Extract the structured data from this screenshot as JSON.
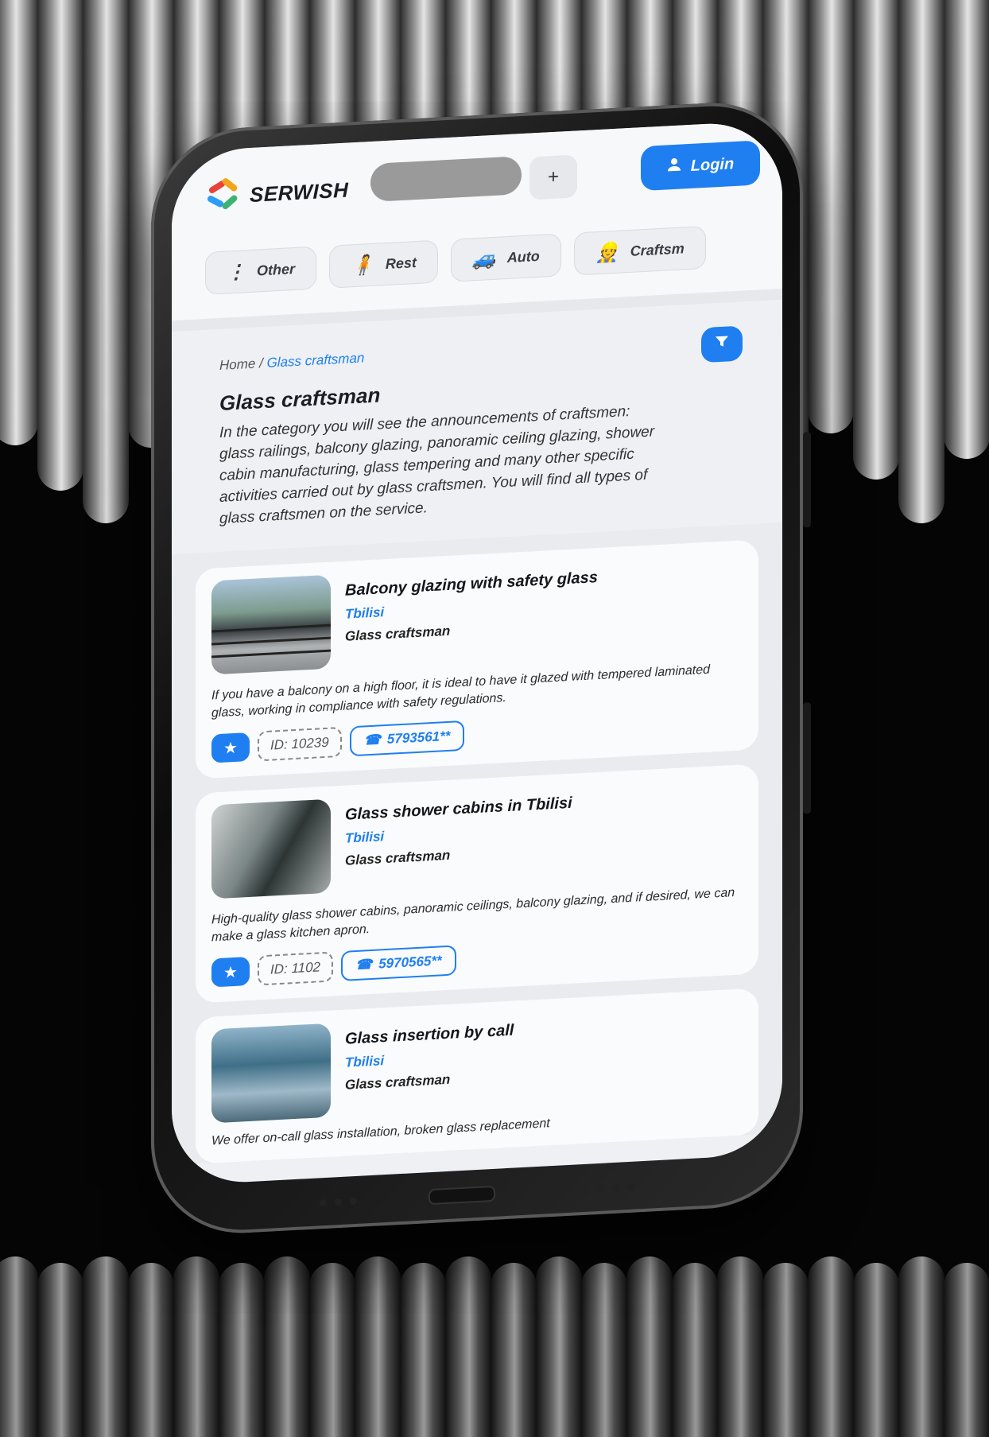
{
  "brand": {
    "name": "SERWISH"
  },
  "header": {
    "plus_label": "+",
    "login_label": "Login"
  },
  "categories": [
    {
      "label": "Other",
      "icon": "more-vertical-icon"
    },
    {
      "label": "Rest",
      "icon": "person-icon"
    },
    {
      "label": "Auto",
      "icon": "car-icon"
    },
    {
      "label": "Craftsm",
      "icon": "workers-icon"
    }
  ],
  "breadcrumb": {
    "home": "Home",
    "separator": "/",
    "current": "Glass craftsman"
  },
  "page": {
    "title": "Glass craftsman",
    "description": "In the category you will see the announcements of craftsmen: glass railings, balcony glazing, panoramic ceiling glazing, shower cabin manufacturing, glass tempering and many other specific activities carried out by glass craftsmen. You will find all types of glass craftsmen on the service."
  },
  "listings": [
    {
      "title": "Balcony glazing with safety glass",
      "city": "Tbilisi",
      "category": "Glass craftsman",
      "description": "If you have a balcony on a high floor, it is ideal to have it glazed with tempered laminated glass, working in compliance with safety regulations.",
      "id": "ID: 10239",
      "phone": "5793561**"
    },
    {
      "title": "Glass shower cabins in Tbilisi",
      "city": "Tbilisi",
      "category": "Glass craftsman",
      "description": "High-quality glass shower cabins, panoramic ceilings, balcony glazing, and if desired, we can make a glass kitchen apron.",
      "id": "ID: 1102",
      "phone": "5970565**"
    },
    {
      "title": "Glass insertion by call",
      "city": "Tbilisi",
      "category": "Glass craftsman",
      "description": "We offer on-call glass installation, broken glass replacement"
    }
  ],
  "colors": {
    "accent": "#1f7ff0",
    "background": "#050505",
    "screen": "#eef0f4"
  }
}
